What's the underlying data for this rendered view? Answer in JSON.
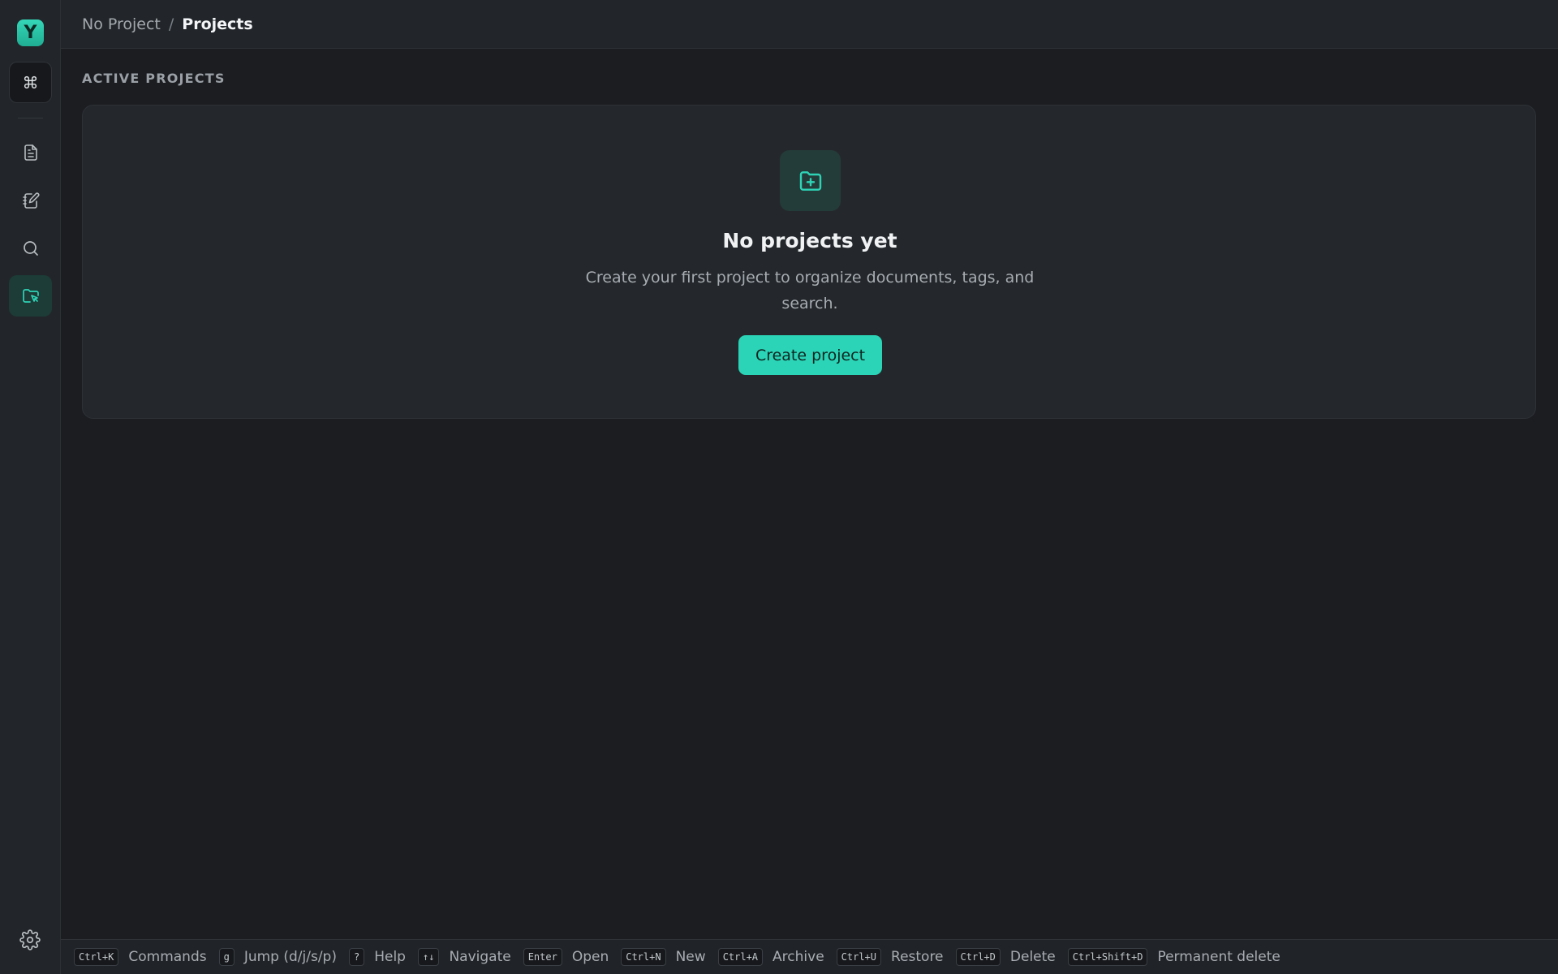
{
  "app": {
    "logo_letter": "Y",
    "accent": "#2bd4b6"
  },
  "sidebar": {
    "command_glyph": "⌘",
    "items": [
      {
        "name": "documents",
        "icon": "document-icon"
      },
      {
        "name": "journal",
        "icon": "notebook-edit-icon"
      },
      {
        "name": "search",
        "icon": "search-icon"
      },
      {
        "name": "projects",
        "icon": "folder-project-icon",
        "active": true
      }
    ],
    "settings_icon": "gear-icon"
  },
  "breadcrumb": {
    "parent": "No Project",
    "separator": "/",
    "current": "Projects"
  },
  "main": {
    "section_title": "ACTIVE PROJECTS",
    "empty": {
      "icon": "folder-plus-icon",
      "title": "No projects yet",
      "description": "Create your first project to organize documents, tags, and search.",
      "button": "Create project"
    }
  },
  "footer": {
    "shortcuts": [
      {
        "key": "Ctrl+K",
        "label": "Commands"
      },
      {
        "key": "g",
        "label": "Jump (d/j/s/p)"
      },
      {
        "key": "?",
        "label": "Help"
      },
      {
        "key": "↑↓",
        "label": "Navigate"
      },
      {
        "key": "Enter",
        "label": "Open"
      },
      {
        "key": "Ctrl+N",
        "label": "New"
      },
      {
        "key": "Ctrl+A",
        "label": "Archive"
      },
      {
        "key": "Ctrl+U",
        "label": "Restore"
      },
      {
        "key": "Ctrl+D",
        "label": "Delete"
      },
      {
        "key": "Ctrl+Shift+D",
        "label": "Permanent delete"
      }
    ]
  }
}
